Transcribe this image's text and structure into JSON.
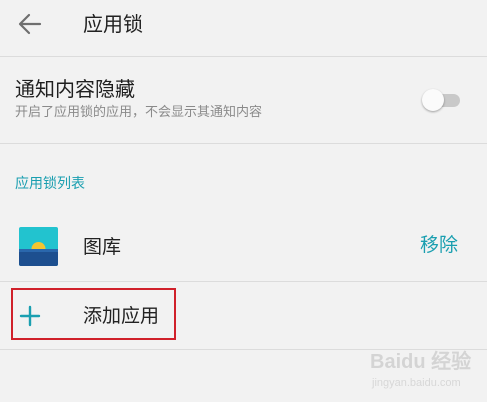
{
  "header": {
    "title": "应用锁"
  },
  "notification_hide": {
    "title": "通知内容隐藏",
    "subtitle": "开启了应用锁的应用，不会显示其通知内容",
    "toggle_on": false
  },
  "app_lock_list": {
    "section_title": "应用锁列表",
    "apps": [
      {
        "name": "图库",
        "action_label": "移除"
      }
    ],
    "add_label": "添加应用"
  },
  "colors": {
    "accent": "#1a9fb0",
    "highlight": "#d0202a",
    "background": "#f2f2f2"
  },
  "watermark": {
    "brand": "Baidu 经验",
    "url": "jingyan.baidu.com"
  }
}
